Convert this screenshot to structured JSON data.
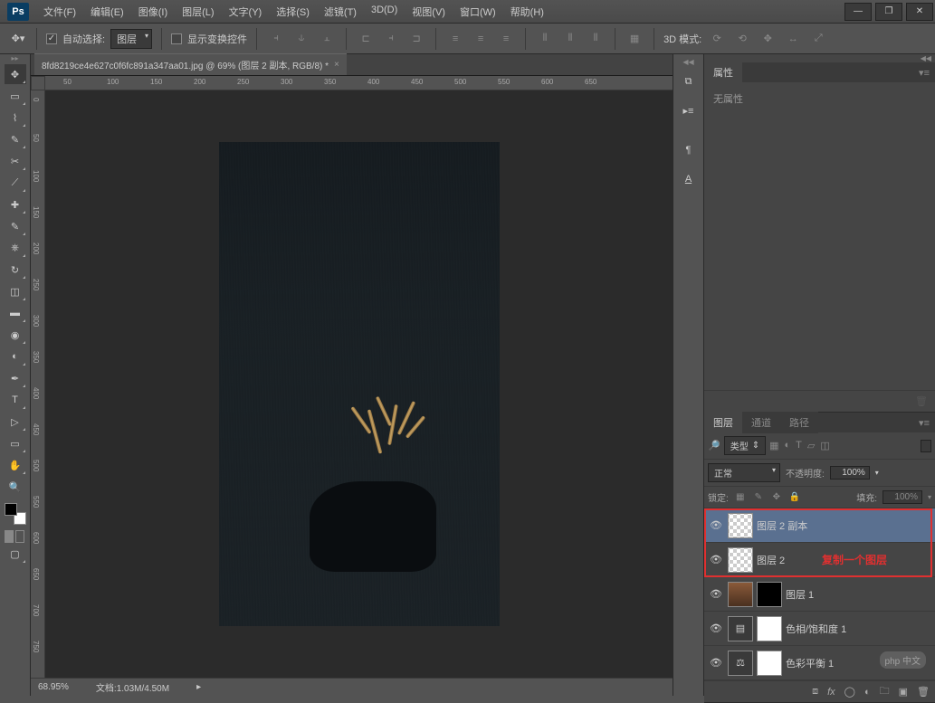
{
  "app": {
    "logo": "Ps"
  },
  "menu": [
    "文件(F)",
    "编辑(E)",
    "图像(I)",
    "图层(L)",
    "文字(Y)",
    "选择(S)",
    "滤镜(T)",
    "3D(D)",
    "视图(V)",
    "窗口(W)",
    "帮助(H)"
  ],
  "window_controls": {
    "min": "—",
    "max": "❐",
    "close": "✕"
  },
  "options": {
    "auto_select": "自动选择:",
    "target": "图层",
    "show_transform": "显示变换控件",
    "mode_3d": "3D 模式:"
  },
  "tab": {
    "title": "8fd8219ce4e627c0f6fc891a347aa01.jpg @ 69% (图层 2 副本, RGB/8) *"
  },
  "ruler_h": [
    "50",
    "100",
    "150",
    "200",
    "250",
    "300",
    "350",
    "400",
    "450",
    "500",
    "550",
    "600",
    "650"
  ],
  "ruler_v": [
    "0",
    "50",
    "100",
    "150",
    "200",
    "250",
    "300",
    "350",
    "400",
    "450",
    "500",
    "550",
    "600",
    "650",
    "700",
    "750"
  ],
  "status": {
    "zoom": "68.95%",
    "doc": "文档:1.03M/4.50M"
  },
  "panels": {
    "properties": {
      "tab": "属性",
      "none": "无属性"
    },
    "layers": {
      "tabs": [
        "图层",
        "通道",
        "路径"
      ],
      "kind_label": "类型",
      "blend_mode": "正常",
      "opacity_label": "不透明度:",
      "opacity_value": "100%",
      "lock_label": "锁定:",
      "fill_label": "填充:",
      "fill_value": "100%",
      "items": [
        {
          "name": "图层 2 副本",
          "selected": true,
          "thumb": "checker"
        },
        {
          "name": "图层 2",
          "selected": false,
          "thumb": "checker"
        },
        {
          "name": "图层 1",
          "selected": false,
          "thumb": "img",
          "mask": true
        },
        {
          "name": "色相/饱和度 1",
          "selected": false,
          "thumb": "adj_hue",
          "mask_white": true
        },
        {
          "name": "色彩平衡 1",
          "selected": false,
          "thumb": "adj_bal",
          "mask_white": true
        }
      ]
    }
  },
  "annotation": "复制一个图层",
  "watermark": "php 中文"
}
